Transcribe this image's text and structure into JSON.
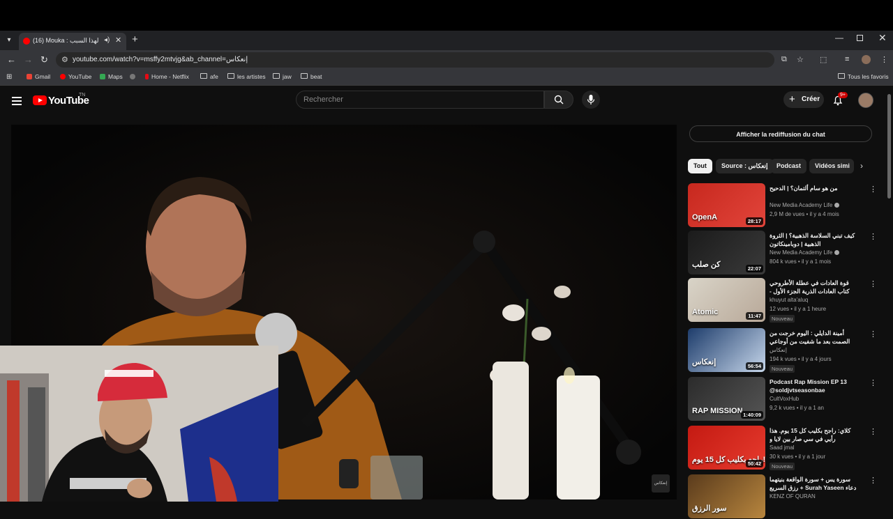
{
  "browser": {
    "tab_title": "(16) Mouka : حتى لهذا السبب",
    "url": "youtube.com/watch?v=msffy2mtvjg&ab_channel=إنعكاس",
    "bookmarks": [
      "Gmail",
      "YouTube",
      "Maps",
      "Home - Netflix",
      "afe",
      "les artistes",
      "jaw",
      "beat"
    ],
    "all_bookmarks": "Tous les favoris"
  },
  "youtube": {
    "logo_text": "YouTube",
    "logo_region": "TN",
    "search_placeholder": "Rechercher",
    "create_label": "Créer",
    "notif_badge": "9+"
  },
  "player": {
    "watermark": "إنعكاس"
  },
  "sidebar": {
    "chat_replay": "Afficher la rediffusion du chat",
    "chips": [
      "Tout",
      "Source : إنعكاس",
      "Podcast",
      "Vidéos simi"
    ],
    "recommendations": [
      {
        "title": "من هو سام ألتمان؟ | الدحيح",
        "channel": "New Media Academy Life",
        "meta": "2,9 M de vues • il y a 4 mois",
        "duration": "28:17",
        "badge": "",
        "thumb_text": "OpenA",
        "colors": [
          "#c7281e",
          "#e2453b"
        ]
      },
      {
        "title": "كيف تبني السلاسة الذهبية؟ | الثروة الذهبية | دوبامينكاتون",
        "channel": "New Media Academy Life",
        "meta": "804 k vues • il y a 1 mois",
        "duration": "22:07",
        "badge": "",
        "thumb_text": "كن صلب",
        "colors": [
          "#1b1b1b",
          "#3a3a3a"
        ]
      },
      {
        "title": "قوة العادات في عطلة الأطروحي كتاب العادات الذرية الجزء الأول - جيمس كلير",
        "channel": "khuyut alta'aluq",
        "meta": "12 vues • il y a 1 heure",
        "duration": "11:47",
        "badge": "Nouveau",
        "thumb_text": "Atomic",
        "colors": [
          "#d9d4c8",
          "#b8a898"
        ]
      },
      {
        "title": "أمينة الدايلي : اليوم خرجت من الصمت بعد ما شفيت من أوجاعي",
        "channel": "إنعكاس",
        "meta": "194 k vues • il y a 4 jours",
        "duration": "56:54",
        "badge": "Nouveau",
        "thumb_text": "إنعكاس",
        "colors": [
          "#1d3c6b",
          "#c6d6ea"
        ]
      },
      {
        "title": "Podcast Rap Mission EP 13 @soldjvtseasonbae",
        "channel": "CultVoxHub",
        "meta": "9,2 k vues • il y a 1 an",
        "duration": "1:40:09",
        "badge": "",
        "thumb_text": "RAP MISSION",
        "colors": [
          "#2b2b2b",
          "#555555"
        ]
      },
      {
        "title": "كلاي: راجح بكليب كل 15 يوم. هذا رأيي في سي صار بين لايا و بوسماعيل و حانتي رسالتي",
        "channel": "Saad jmal",
        "meta": "30 k vues • il y a 1 jour",
        "duration": "50:42",
        "badge": "Nouveau",
        "thumb_text": "راجع بكليب كل 15 يوم!",
        "colors": [
          "#c41a12",
          "#e63b2e"
        ]
      },
      {
        "title": "سورة يس + سورة الواقعة بنيتهما دعاء Surah Yaseen + رزق السريع بإذن الله",
        "channel": "KENZ OF QURAN",
        "meta": "",
        "duration": "",
        "badge": "",
        "thumb_text": "سور الرزق",
        "colors": [
          "#5a3b1c",
          "#b8863e"
        ]
      }
    ]
  },
  "colors": {
    "bg": "#0f0f0f",
    "brand": "#ff0000",
    "accent_text": "#f1f1f1",
    "muted": "#aaaaaa"
  }
}
